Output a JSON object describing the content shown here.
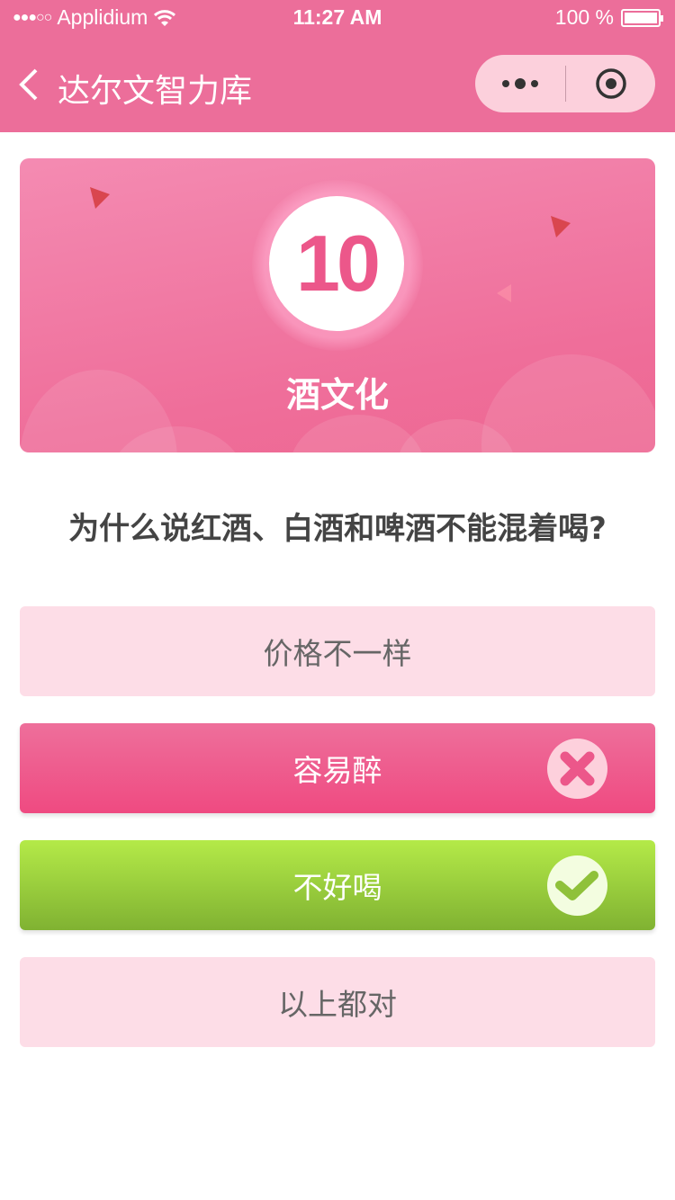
{
  "status_bar": {
    "signal": "●●●○○",
    "carrier": "Applidium",
    "time": "11:27 AM",
    "battery": "100 %",
    "battery_level": 1.0
  },
  "nav": {
    "title": "达尔文智力库",
    "icons": [
      "back-chevron-icon",
      "more-dots-icon",
      "close-target-icon"
    ]
  },
  "colors": {
    "brand": "#ec6e9a",
    "wrong": "#ef4a81",
    "correct": "#80b232",
    "option_bg": "#fddde7"
  },
  "quiz": {
    "number": "10",
    "category": "酒文化",
    "question": "为什么说红酒、白酒和啤酒不能混着喝?",
    "options": [
      {
        "label": "价格不一样",
        "state": "neutral"
      },
      {
        "label": "容易醉",
        "state": "wrong",
        "icon": "x-circle-icon"
      },
      {
        "label": "不好喝",
        "state": "correct",
        "icon": "check-circle-icon"
      },
      {
        "label": "以上都对",
        "state": "neutral"
      }
    ]
  }
}
